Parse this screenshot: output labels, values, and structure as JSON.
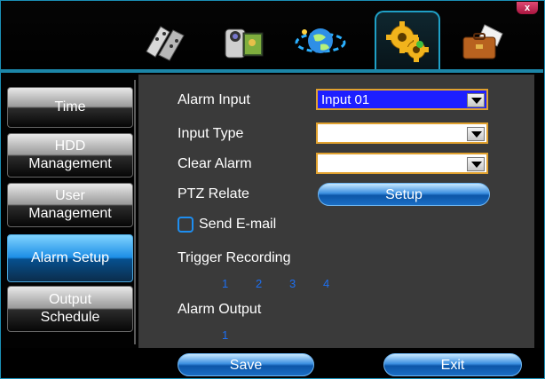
{
  "window": {
    "close_label": "x"
  },
  "tabs": [
    {
      "name": "record",
      "icon": "film-icon"
    },
    {
      "name": "camera",
      "icon": "camcorder-icon"
    },
    {
      "name": "network",
      "icon": "globe-icon"
    },
    {
      "name": "settings",
      "icon": "gears-icon",
      "active": true
    },
    {
      "name": "tools",
      "icon": "briefcase-icon"
    }
  ],
  "sidebar": {
    "items": [
      {
        "label": "Time"
      },
      {
        "label": "HDD\nManagement"
      },
      {
        "label": "User\nManagement"
      },
      {
        "label": "Alarm Setup",
        "active": true
      },
      {
        "label": "Output\nSchedule"
      }
    ]
  },
  "form": {
    "alarm_input": {
      "label": "Alarm Input",
      "value": "Input 01"
    },
    "input_type": {
      "label": "Input Type",
      "value": ""
    },
    "clear_alarm": {
      "label": "Clear Alarm",
      "value": ""
    },
    "ptz_relate": {
      "label": "PTZ Relate",
      "button": "Setup"
    },
    "send_email": {
      "label": "Send E-mail",
      "checked": false
    },
    "trigger_recording": {
      "label": "Trigger Recording",
      "channels": [
        "1",
        "2",
        "3",
        "4"
      ]
    },
    "alarm_output": {
      "label": "Alarm Output",
      "channels": [
        "1"
      ]
    }
  },
  "footer": {
    "save_label": "Save",
    "exit_label": "Exit"
  },
  "colors": {
    "accent": "#1fa0c6",
    "highlight": "#1d1fff",
    "select_border": "#e0a12f",
    "channel_text": "#1d6ff0"
  }
}
